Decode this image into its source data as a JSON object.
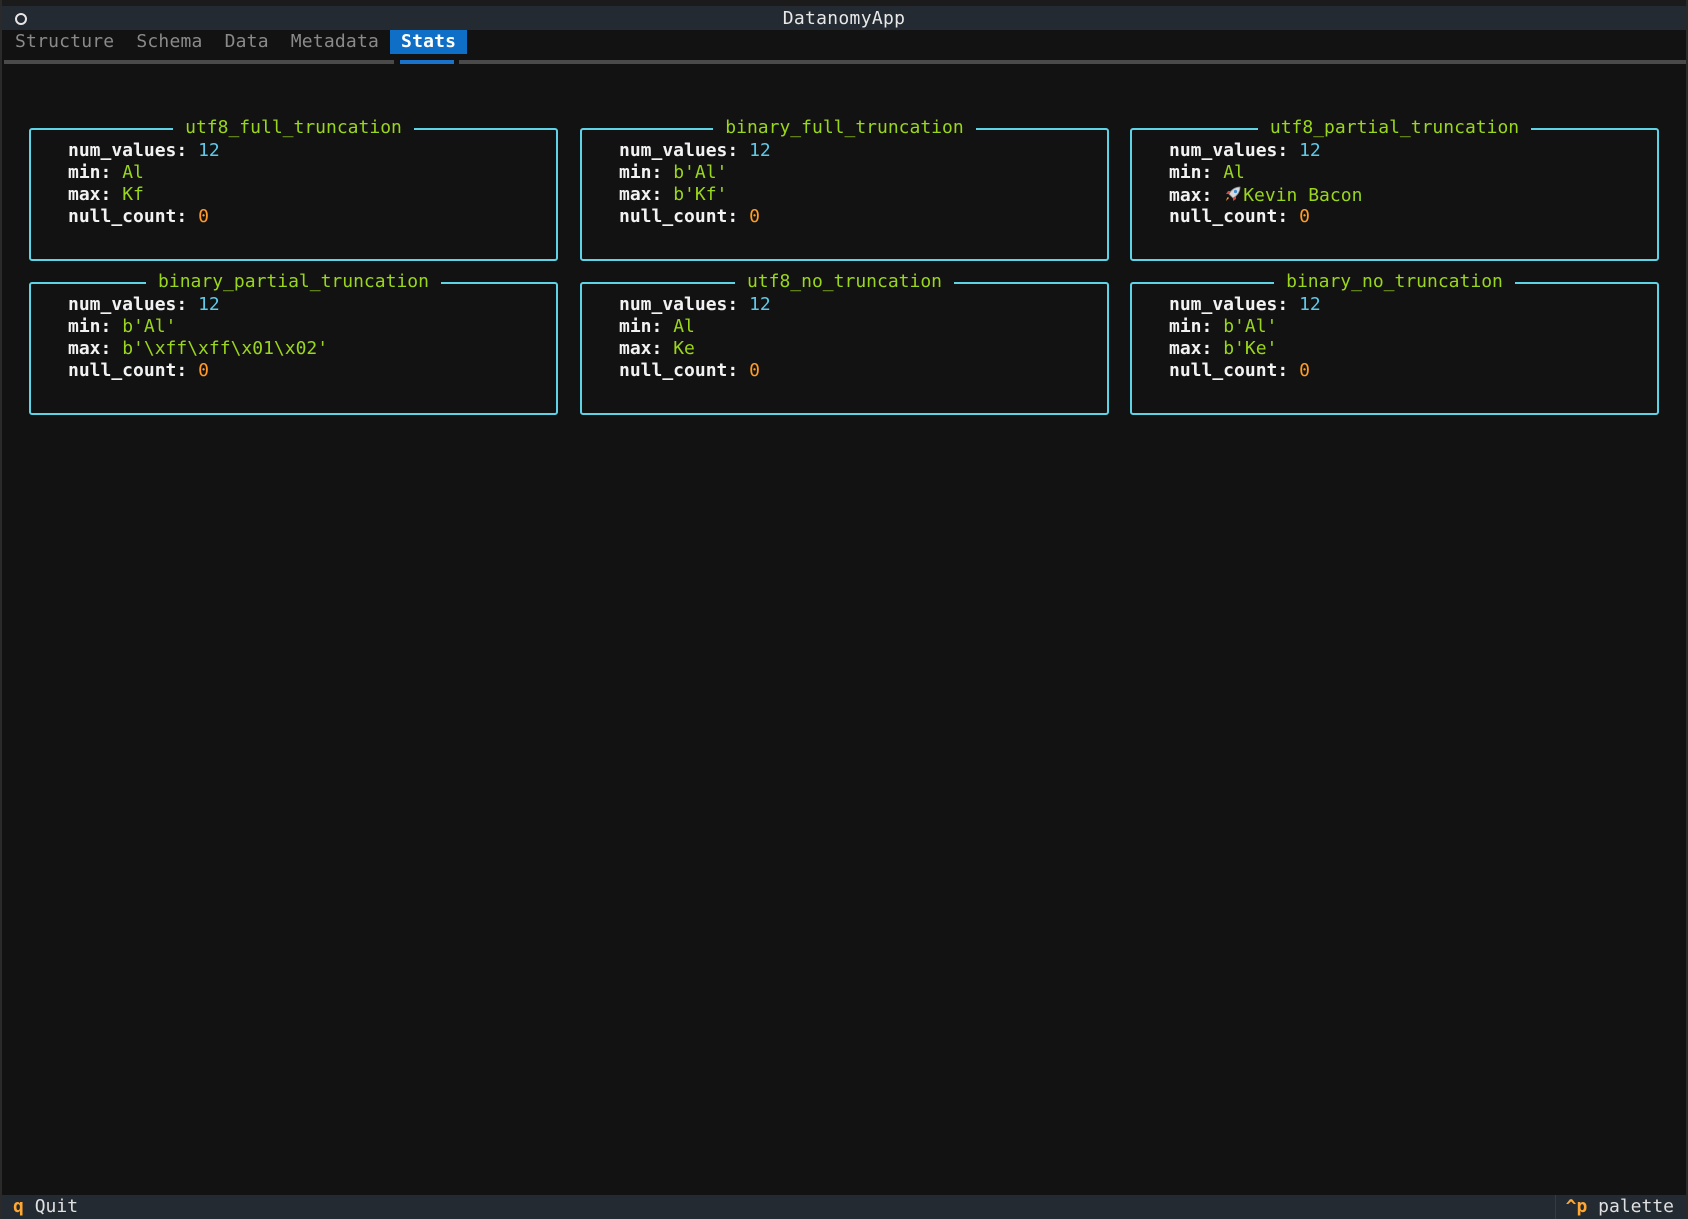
{
  "window": {
    "title": "DatanomyApp"
  },
  "tabs": [
    {
      "label": "Structure",
      "active": false
    },
    {
      "label": "Schema",
      "active": false
    },
    {
      "label": "Data",
      "active": false
    },
    {
      "label": "Metadata",
      "active": false
    },
    {
      "label": "Stats",
      "active": true
    }
  ],
  "field_labels": {
    "num_values": "num_values:",
    "min": "min:",
    "max": "max:",
    "null_count": "null_count:"
  },
  "panels": [
    {
      "title": "utf8_full_truncation",
      "num_values": "12",
      "min": "Al",
      "max": "Kf",
      "null_count": "0"
    },
    {
      "title": "binary_full_truncation",
      "num_values": "12",
      "min": "b'Al'",
      "max": "b'Kf'",
      "null_count": "0"
    },
    {
      "title": "utf8_partial_truncation",
      "num_values": "12",
      "min": "Al",
      "max": "Kevin Bacon",
      "max_icon": "rocket-icon",
      "null_count": "0"
    },
    {
      "title": "binary_partial_truncation",
      "num_values": "12",
      "min": "b'Al'",
      "max": "b'\\xff\\xff\\x01\\x02'",
      "null_count": "0"
    },
    {
      "title": "utf8_no_truncation",
      "num_values": "12",
      "min": "Al",
      "max": "Ke",
      "null_count": "0"
    },
    {
      "title": "binary_no_truncation",
      "num_values": "12",
      "min": "b'Al'",
      "max": "b'Ke'",
      "null_count": "0"
    }
  ],
  "footer": {
    "quit_key": "q",
    "quit_label": "Quit",
    "palette_key": "^p",
    "palette_label": "palette"
  },
  "colors": {
    "background": "#121212",
    "panel_border": "#5fd3e6",
    "title_text": "#9ad61b",
    "number_value": "#5ec9e8",
    "string_value": "#9ad61b",
    "zero_value": "#ff9b26",
    "active_tab": "#0f6fc6",
    "footer_key": "#ffa733"
  }
}
